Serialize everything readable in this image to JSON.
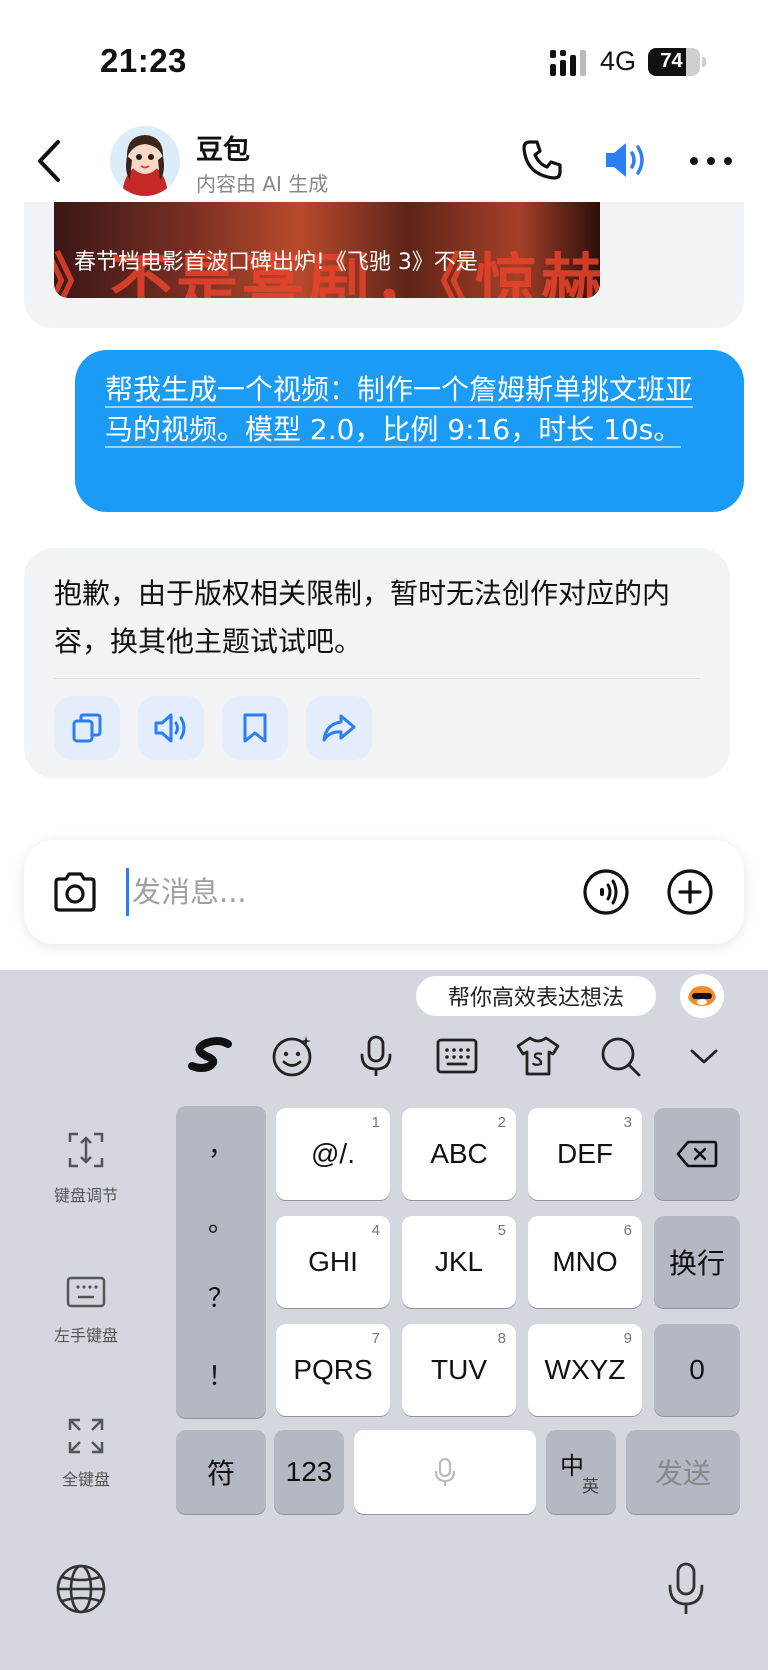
{
  "status": {
    "time": "21:23",
    "network": "4G",
    "battery": "74"
  },
  "header": {
    "name": "豆包",
    "subtitle": "内容由 AI 生成"
  },
  "previous_card": {
    "caption": "春节档电影首波口碑出炉!《飞驰 3》不是",
    "thumb_text": "》不是喜剧，《惊赫"
  },
  "user_message": {
    "text": "帮我生成一个视频：制作一个詹姆斯单挑文班亚马的视频。模型 2.0，比例 9:16，时长 10s。"
  },
  "bot_message": {
    "text": "抱歉，由于版权相关限制，暂时无法创作对应的内容，换其他主题试试吧。"
  },
  "input": {
    "placeholder": "发消息..."
  },
  "keyboard": {
    "hint": "帮你高效表达想法",
    "side": [
      "键盘调节",
      "左手键盘",
      "全键盘"
    ],
    "punct": [
      "，",
      "。",
      "？",
      "！"
    ],
    "keys_row1": [
      {
        "label": "@/.",
        "num": "1"
      },
      {
        "label": "ABC",
        "num": "2"
      },
      {
        "label": "DEF",
        "num": "3"
      }
    ],
    "keys_row2": [
      {
        "label": "GHI",
        "num": "4"
      },
      {
        "label": "JKL",
        "num": "5"
      },
      {
        "label": "MNO",
        "num": "6"
      }
    ],
    "keys_row3": [
      {
        "label": "PQRS",
        "num": "7"
      },
      {
        "label": "TUV",
        "num": "8"
      },
      {
        "label": "WXYZ",
        "num": "9"
      }
    ],
    "enter_label": "换行",
    "zero_label": "0",
    "symbol_label": "符",
    "num_label": "123",
    "lang_main": "中",
    "lang_sub": "英",
    "send_label": "发送"
  },
  "colors": {
    "accent": "#1a9bf5",
    "icon_blue": "#2a7ff2",
    "keyboard_bg": "#d4d7de"
  }
}
